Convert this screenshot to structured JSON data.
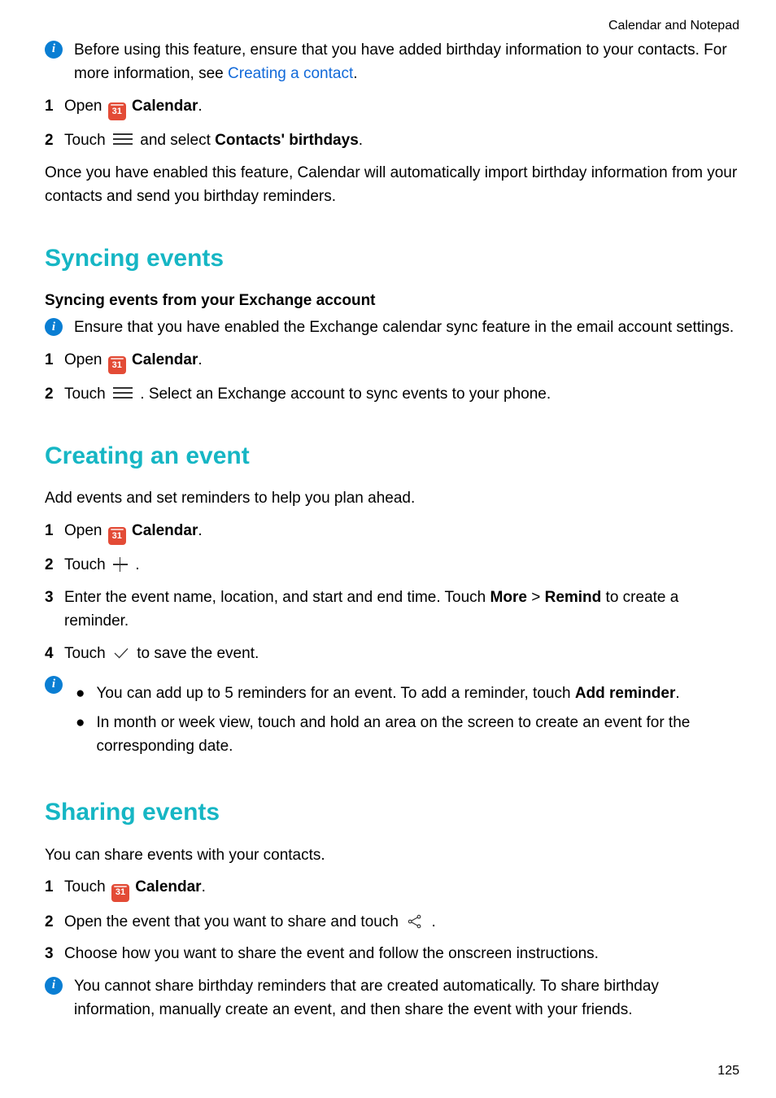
{
  "header": {
    "breadcrumb": "Calendar and Notepad"
  },
  "intro_note": {
    "text_before_link": "Before using this feature, ensure that you have added birthday information to your contacts. For more information, see ",
    "link_text": "Creating a contact",
    "text_after_link": "."
  },
  "intro_steps": {
    "s1_a": "Open ",
    "s1_cal": "31",
    "s1_b": " Calendar",
    "s1_c": ".",
    "s2_a": "Touch ",
    "s2_b": " and select ",
    "s2_bold": "Contacts' birthdays",
    "s2_c": "."
  },
  "intro_para": "Once you have enabled this feature, Calendar will automatically import birthday information from your contacts and send you birthday reminders.",
  "syncing": {
    "heading": "Syncing events",
    "subhead": "Syncing events from your Exchange account",
    "note": "Ensure that you have enabled the Exchange calendar sync feature in the email account settings.",
    "s1_a": "Open ",
    "s1_cal": "31",
    "s1_b": " Calendar",
    "s1_c": ".",
    "s2_a": "Touch ",
    "s2_b": " . Select an Exchange account to sync events to your phone."
  },
  "creating": {
    "heading": "Creating an event",
    "intro": "Add events and set reminders to help you plan ahead.",
    "s1_a": "Open ",
    "s1_cal": "31",
    "s1_b": " Calendar",
    "s1_c": ".",
    "s2_a": "Touch ",
    "s2_b": " .",
    "s3_a": "Enter the event name, location, and start and end time. Touch ",
    "s3_more": "More",
    "s3_gt": " > ",
    "s3_remind": "Remind",
    "s3_b": " to create a reminder.",
    "s4_a": "Touch ",
    "s4_b": " to save the event.",
    "bullet1_a": "You can add up to 5 reminders for an event. To add a reminder, touch ",
    "bullet1_bold": "Add reminder",
    "bullet1_b": ".",
    "bullet2": "In month or week view, touch and hold an area on the screen to create an event for the corresponding date."
  },
  "sharing": {
    "heading": "Sharing events",
    "intro": "You can share events with your contacts.",
    "s1_a": "Touch ",
    "s1_cal": "31",
    "s1_b": " Calendar",
    "s1_c": ".",
    "s2_a": "Open the event that you want to share and touch ",
    "s2_b": " .",
    "s3": "Choose how you want to share the event and follow the onscreen instructions.",
    "note": "You cannot share birthday reminders that are created automatically. To share birthday information, manually create an event, and then share the event with your friends."
  },
  "page_number": "125"
}
